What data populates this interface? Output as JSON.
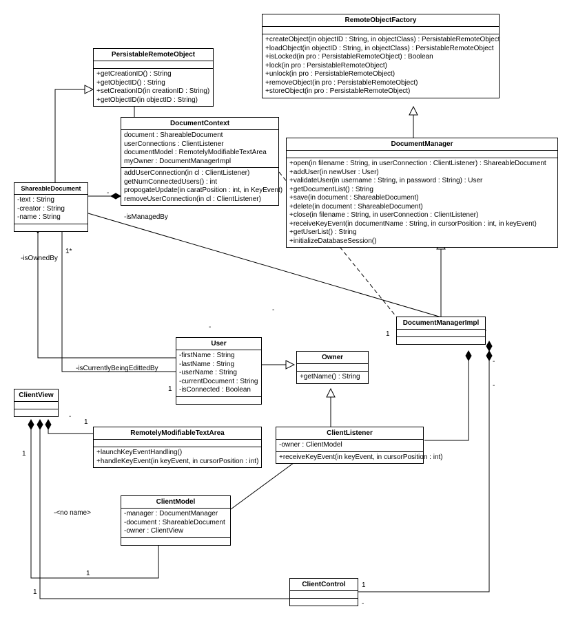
{
  "classes": {
    "persistableRemoteObject": {
      "name": "PersistableRemoteObject",
      "attrs": [],
      "ops": [
        "+getCreationID() : String",
        "+getObjectID() : String",
        "+setCreationID(in creationID : String)",
        "+getObjectID(in objectID : String)"
      ]
    },
    "remoteObjectFactory": {
      "name": "RemoteObjectFactory",
      "attrs": [],
      "ops": [
        "+createObject(in objectID : String, in objectClass) : PersistableRemoteObject",
        "+loadObject(in objectID : String, in objectClass) : PersistableRemoteObject",
        "+isLocked(in pro : PersistableRemoteObject) : Boolean",
        "+lock(in pro : PersistableRemoteObject)",
        "+unlock(in pro : PersistableRemoteObject)",
        "+removeObject(in pro : PersistableRemoteObject)",
        "+storeObject(in pro : PersistableRemoteObject)"
      ]
    },
    "documentContext": {
      "name": "DocumentContext",
      "attrs": [
        "document : ShareableDocument",
        "userConnections : ClientListener",
        "documentModel : RemotelyModifiableTextArea",
        "myOwner : DocumentManagerImpl"
      ],
      "ops": [
        "addUserConnection(in cl : ClientListener)",
        "getNumConnectedUsers() : int",
        "propogateUpdate(in caratPosition : int, in KeyEvent)",
        "removeUserConnection(in cl : ClientListener)"
      ]
    },
    "documentManager": {
      "name": "DocumentManager",
      "attrs": [],
      "ops": [
        "+open(in filename : String, in userConnection : ClientListener) : ShareableDocument",
        "+addUser(in newUser : User)",
        "+validateUser(in username : String, in password : String) : User",
        "+getDocumentList() : String",
        "+save(in document : ShareableDocument)",
        "+delete(in document : ShareableDocument)",
        "+close(in filename : String, in userConnection : ClientListener)",
        "+receiveKeyEvent(in documentName : String, in cursorPosition : int, in keyEvent)",
        "+getUserList() : String",
        "+initializeDatabaseSession()"
      ]
    },
    "shareableDocument": {
      "name": "ShareableDocument",
      "attrs": [
        "-text : String",
        "-creator : String",
        "-name : String"
      ],
      "ops": []
    },
    "user": {
      "name": "User",
      "attrs": [
        "-firstName : String",
        "-lastName : String",
        "-userName : String",
        "-currentDocument : String",
        "-isConnected : Boolean"
      ],
      "ops": []
    },
    "owner": {
      "name": "Owner",
      "attrs": [],
      "ops": [
        "+getName() : String"
      ]
    },
    "documentManagerImpl": {
      "name": "DocumentManagerImpl",
      "attrs": [],
      "ops": []
    },
    "clientView": {
      "name": "ClientView",
      "attrs": [],
      "ops": []
    },
    "remotelyModifiableTextArea": {
      "name": "RemotelyModifiableTextArea",
      "attrs": [],
      "ops": [
        "+launchKeyEventHandling()",
        "+handleKeyEvent(in keyEvent, in cursorPosition : int)"
      ]
    },
    "clientListener": {
      "name": "ClientListener",
      "attrs": [
        "-owner : ClientModel"
      ],
      "ops": [
        "+receiveKeyEvent(in keyEvent, in cursorPosition : int)"
      ]
    },
    "clientModel": {
      "name": "ClientModel",
      "attrs": [
        "-manager : DocumentManager",
        "-document : ShareableDocument",
        "-owner : ClientView"
      ],
      "ops": []
    },
    "clientControl": {
      "name": "ClientControl",
      "attrs": [],
      "ops": []
    }
  },
  "labels": {
    "isManagedBy": "-isManagedBy",
    "isOwnedBy": "-isOwnedBy",
    "isCurrentlyBeingEdittedBy": "-isCurrentlyBeingEdittedBy",
    "noName": "-<no name>",
    "oneStar": "1*",
    "one": "1",
    "dash": "-"
  }
}
